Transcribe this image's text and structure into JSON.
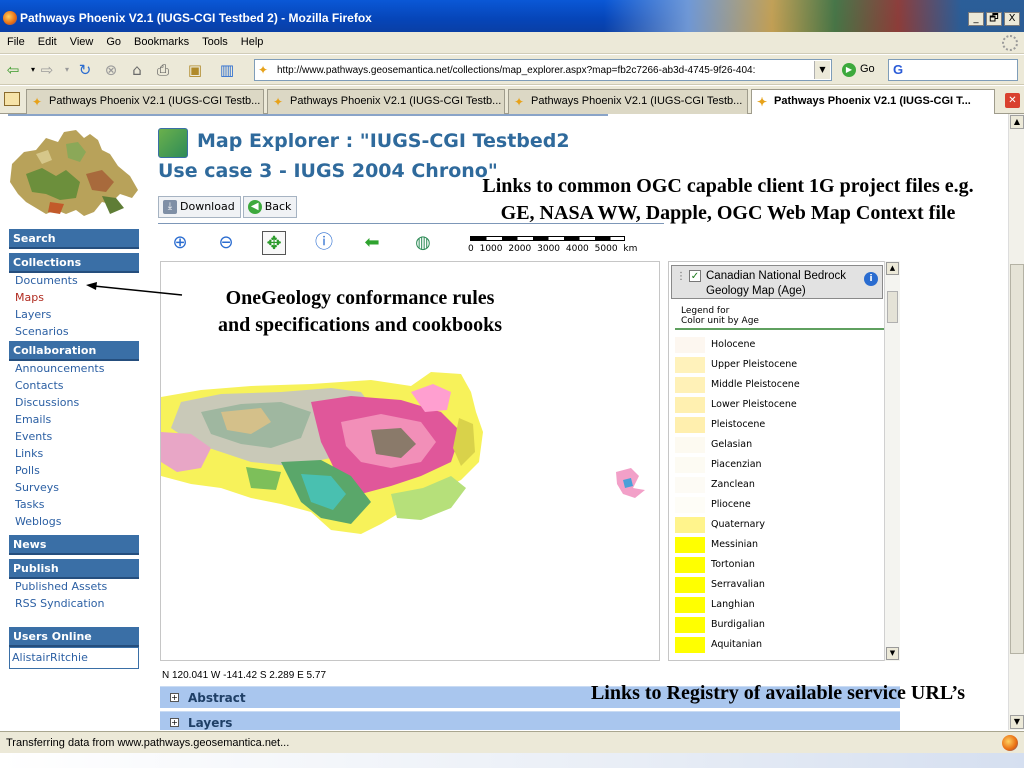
{
  "window": {
    "title": "Pathways Phoenix V2.1 (IUGS-CGI Testbed 2) - Mozilla Firefox",
    "controls": [
      "_",
      "🗗",
      "X"
    ]
  },
  "menu": [
    "File",
    "Edit",
    "View",
    "Go",
    "Bookmarks",
    "Tools",
    "Help"
  ],
  "navbar": {
    "url": "http://www.pathways.geosemantica.net/collections/map_explorer.aspx?map=fb2c7266-ab3d-4745-9f26-404:",
    "go_label": "Go",
    "search_letter": "G"
  },
  "tabs": [
    {
      "label": "Pathways Phoenix V2.1 (IUGS-CGI Testb...",
      "active": false
    },
    {
      "label": "Pathways Phoenix V2.1 (IUGS-CGI Testb...",
      "active": false
    },
    {
      "label": "Pathways Phoenix V2.1 (IUGS-CGI Testb...",
      "active": false
    },
    {
      "label": "Pathways Phoenix V2.1 (IUGS-CGI T...",
      "active": true
    }
  ],
  "sidebar": {
    "search_header": "Search",
    "collections_header": "Collections",
    "collections": [
      "Documents",
      "Maps",
      "Layers",
      "Scenarios"
    ],
    "current": "Maps",
    "collaboration_header": "Collaboration",
    "collaboration": [
      "Announcements",
      "Contacts",
      "Discussions",
      "Emails",
      "Events",
      "Links",
      "Polls",
      "Surveys",
      "Tasks",
      "Weblogs"
    ],
    "news_header": "News",
    "publish_header": "Publish",
    "publish": [
      "Published Assets",
      "RSS Syndication"
    ],
    "users_online_header": "Users Online",
    "users_online": [
      "AlistairRitchie"
    ]
  },
  "explorer": {
    "title": "Map Explorer : \"IUGS-CGI Testbed2",
    "subtitle": "Use case 3 - IUGS 2004 Chrono\"",
    "download_label": "Download",
    "back_label": "Back",
    "scale_labels": "0  1000  2000  3000  4000  5000  km",
    "coords": "N 120.041  W -141.42  S 2.289  E 5.77"
  },
  "legend": {
    "layer_name": "Canadian National Bedrock Geology Map (Age)",
    "checked": true,
    "caption_line1": "Legend for",
    "caption_line2": "Color unit by Age",
    "items": [
      {
        "label": "Holocene",
        "color": "#fdf7f0"
      },
      {
        "label": "Upper Pleistocene",
        "color": "#fff2bb"
      },
      {
        "label": "Middle Pleistocene",
        "color": "#fff1b7"
      },
      {
        "label": "Lower Pleistocene",
        "color": "#fff0b0"
      },
      {
        "label": "Pleistocene",
        "color": "#ffefae"
      },
      {
        "label": "Gelasian",
        "color": "#fdfaf1"
      },
      {
        "label": "Piacenzian",
        "color": "#fdfbf3"
      },
      {
        "label": "Zanclean",
        "color": "#fdfbf5"
      },
      {
        "label": "Pliocene",
        "color": "#fefdf7"
      },
      {
        "label": "Quaternary",
        "color": "#fff48c"
      },
      {
        "label": "Messinian",
        "color": "#ffff00"
      },
      {
        "label": "Tortonian",
        "color": "#ffff00"
      },
      {
        "label": "Serravalian",
        "color": "#ffff00"
      },
      {
        "label": "Langhian",
        "color": "#ffff00"
      },
      {
        "label": "Burdigalian",
        "color": "#ffff00"
      },
      {
        "label": "Aquitanian",
        "color": "#ffff00"
      }
    ]
  },
  "accordion": [
    "Abstract",
    "Layers"
  ],
  "annotations": {
    "ogc_line1": "Links to common OGC capable client 1G project files e.g.",
    "ogc_line2": "GE, NASA WW, Dapple, OGC Web Map Context file",
    "rules_line1": "OneGeology conformance rules",
    "rules_line2": "and specifications and cookbooks",
    "registry": "Links to Registry of available service URL’s"
  },
  "status": {
    "text": "Transferring data from www.pathways.geosemantica.net..."
  }
}
